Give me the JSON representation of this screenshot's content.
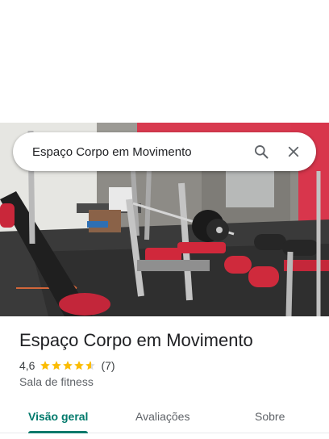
{
  "search": {
    "query": "Espaço Corpo em Movimento",
    "search_icon": "search-icon",
    "close_icon": "close-icon"
  },
  "place": {
    "name": "Espaço Corpo em Movimento",
    "rating": "4,6",
    "stars": 4.6,
    "review_count": "(7)",
    "category": "Sala de fitness"
  },
  "tabs": [
    {
      "label": "Visão geral",
      "active": true
    },
    {
      "label": "Avaliações",
      "active": false
    },
    {
      "label": "Sobre",
      "active": false
    }
  ],
  "colors": {
    "accent": "#00796b",
    "star": "#fbbc04"
  }
}
